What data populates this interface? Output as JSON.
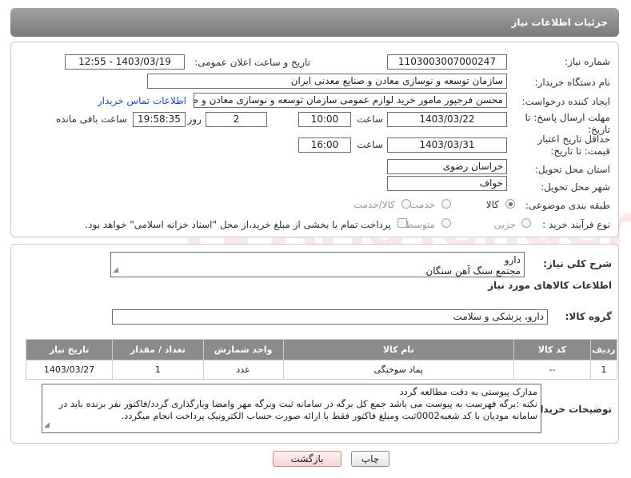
{
  "header": {
    "title": "جزئیات اطلاعات نیاز"
  },
  "form": {
    "need_number": {
      "label": "شماره نیاز:",
      "value": "1103003007000247"
    },
    "announce_datetime": {
      "label": "تاریخ و ساعت اعلان عمومی:",
      "value": "1403/03/19 - 12:55"
    },
    "buyer_org": {
      "label": "نام دستگاه خریدار:",
      "value": "سازمان توسعه و نوسازی معادن و صنایع معدنی ایران"
    },
    "requester": {
      "label": "ایجاد کننده درخواست:",
      "value": "محسن فرجپور مامور خرید لوازم عمومی سازمان توسعه و نوسازی معادن و صنایع",
      "contact_link": "اطلاعات تماس خریدار"
    },
    "reply_deadline": {
      "label": "مهلت ارسال پاسخ: تا تاریخ:",
      "date": "1403/03/22",
      "time_label": "ساعت",
      "time": "10:00",
      "days": "2",
      "days_label": "روز و",
      "remaining": "19:58:35",
      "remaining_label": "ساعت باقی مانده"
    },
    "price_validity": {
      "label": "حداقل تاریخ اعتبار قیمت: تا تاریخ:",
      "date": "1403/03/31",
      "time_label": "ساعت",
      "time": "16:00"
    },
    "province": {
      "label": "استان محل تحویل:",
      "value": "خراسان رضوی"
    },
    "city": {
      "label": "شهر محل تحویل:",
      "value": "خواف"
    },
    "category": {
      "label": "طبقه بندی موضوعی:",
      "options": [
        "کالا",
        "خدمت",
        "کالا/خدمت"
      ],
      "selected": "کالا"
    },
    "purchase_type": {
      "label": "نوع فرآیند خرید :",
      "options": [
        "جزیی",
        "متوسط"
      ],
      "note": "پرداخت تمام یا بخشی از مبلغ خرید،از محل \"اسناد خزانه اسلامی\" خواهد بود."
    }
  },
  "details": {
    "summary_label": "شرح کلی نیاز:",
    "summary_lines": [
      "دارو",
      "مجتمع سنگ آهن سنگان"
    ],
    "goods_info_title": "اطلاعات کالاهای مورد نیاز",
    "goods_group_label": "گروه کالا:",
    "goods_group_value": "دارو، پزشکی و سلامت",
    "table": {
      "headers": [
        "ردیف",
        "کد کالا",
        "نام کالا",
        "واحد شمارش",
        "تعداد / مقدار",
        "تاریخ نیاز"
      ],
      "rows": [
        [
          "1",
          "--",
          "پماد سوختگی",
          "عدد",
          "1",
          "1403/03/27"
        ]
      ]
    },
    "buyer_notes_label": "توضیحات خریدار:",
    "buyer_notes_lines": [
      "مدارک پیوستی به دقت مطالعه گردد",
      "نکته :برگه فهرست به پیوست می باشد جمع کل برگه در سامانه ثبت وبرگه مهر وامضا وبارگذاری گردد/فاکتور نفر برنده باید در",
      "سامانه مودیان با کد شعبه0002ثبت ومبلغ فاکتور فقط با ارائه صورت حساب الکترونیک پرداخت انجام میگردد."
    ]
  },
  "buttons": {
    "print": "چاپ",
    "back": "بازگشت"
  },
  "watermark": {
    "text": "AriaTender.neT"
  }
}
